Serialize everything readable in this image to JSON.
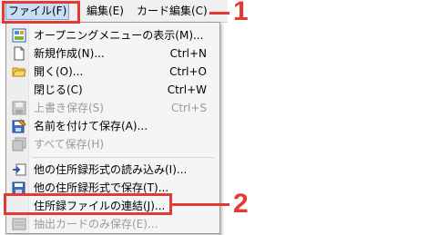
{
  "menubar": {
    "items": [
      {
        "label": "ファイル(F)"
      },
      {
        "label": "編集(E)"
      },
      {
        "label": "カード編集(C)"
      }
    ]
  },
  "menu": {
    "items": [
      {
        "label": "オープニングメニューの表示(M)...",
        "shortcut": "",
        "icon": "opening-menu-icon",
        "disabled": false
      },
      {
        "label": "新規作成(N)...",
        "shortcut": "Ctrl+N",
        "icon": "new-document-icon",
        "disabled": false
      },
      {
        "label": "開く(O)...",
        "shortcut": "Ctrl+O",
        "icon": "open-folder-icon",
        "disabled": false
      },
      {
        "label": "閉じる(C)",
        "shortcut": "Ctrl+W",
        "icon": "",
        "disabled": false
      },
      {
        "label": "上書き保存(S)",
        "shortcut": "Ctrl+S",
        "icon": "save-icon",
        "disabled": true
      },
      {
        "label": "名前を付けて保存(A)...",
        "shortcut": "",
        "icon": "save-as-icon",
        "disabled": false
      },
      {
        "label": "すべて保存(H)",
        "shortcut": "",
        "icon": "save-all-icon",
        "disabled": true
      },
      {
        "label": "他の住所録形式の読み込み(I)...",
        "shortcut": "",
        "icon": "import-icon",
        "disabled": false
      },
      {
        "label": "他の住所録形式で保存(T)...",
        "shortcut": "",
        "icon": "export-icon",
        "disabled": false
      },
      {
        "label": "住所録ファイルの連結(J)...",
        "shortcut": "",
        "icon": "",
        "disabled": false
      },
      {
        "label": "抽出カードのみ保存(E)...",
        "shortcut": "",
        "icon": "extract-save-icon",
        "disabled": true
      }
    ]
  },
  "callouts": [
    {
      "number": "1"
    },
    {
      "number": "2"
    }
  ],
  "colors": {
    "callout_red": "#e53935"
  }
}
